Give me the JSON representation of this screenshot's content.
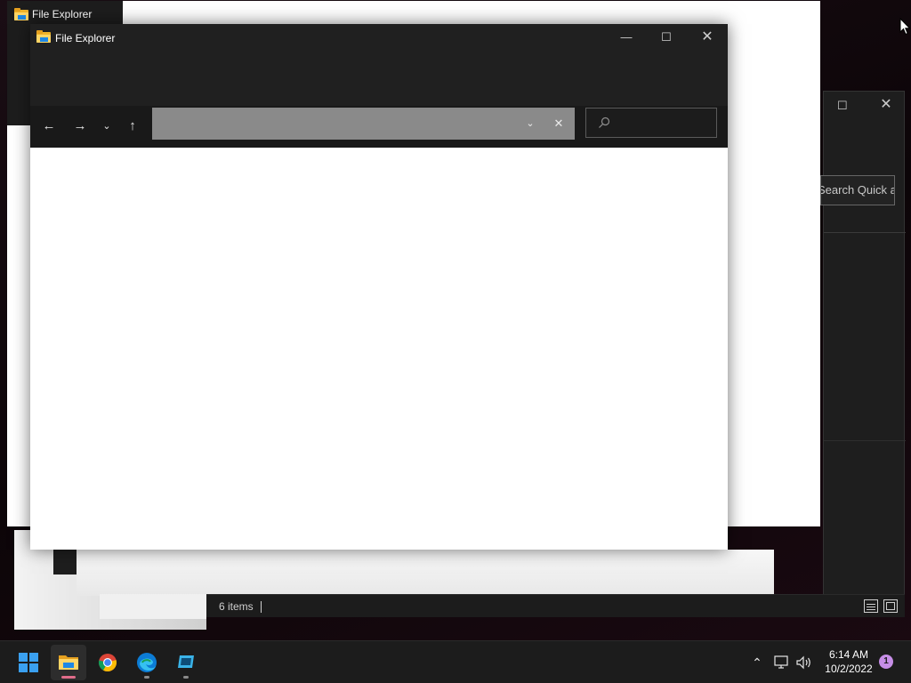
{
  "background_windows": {
    "left": {
      "title": "File Explorer"
    },
    "right": {
      "search_placeholder": "Search Quick access"
    }
  },
  "status_bar": {
    "item_count": "6 items"
  },
  "front_window": {
    "title": "File Explorer",
    "controls": {
      "minimize": "—",
      "maximize": "☐",
      "close": "✕"
    },
    "nav": {
      "back": "←",
      "forward": "→",
      "recent": "⌄",
      "up": "↑"
    },
    "address": {
      "value": "",
      "dropdown": "⌄",
      "clear": "✕"
    },
    "search": {
      "placeholder": ""
    }
  },
  "taskbar": {
    "apps": [
      {
        "name": "start-icon"
      },
      {
        "name": "file-explorer-icon",
        "active": true
      },
      {
        "name": "chrome-icon"
      },
      {
        "name": "edge-icon"
      },
      {
        "name": "app-icon"
      }
    ],
    "tray": {
      "chevron": "⌃"
    },
    "clock": {
      "time": "6:14 AM",
      "date": "10/2/2022"
    },
    "notifications": "1"
  },
  "colors": {
    "accent_indicator": "#e06c8a",
    "window_dark": "#202020",
    "address_bar": "#8a8a8a",
    "notification_badge": "#c68ee6"
  }
}
